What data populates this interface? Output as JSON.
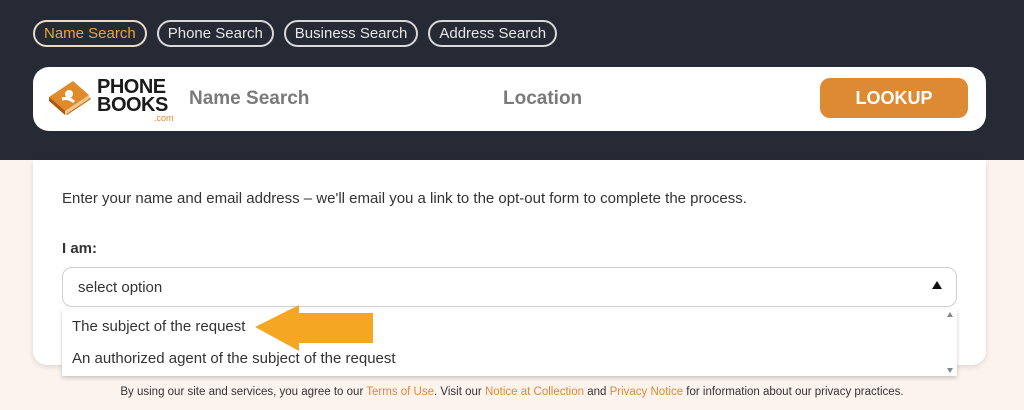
{
  "tabs": [
    {
      "label": "Name Search",
      "active": true
    },
    {
      "label": "Phone Search",
      "active": false
    },
    {
      "label": "Business Search",
      "active": false
    },
    {
      "label": "Address Search",
      "active": false
    }
  ],
  "logo": {
    "line1": "PHONE",
    "line2": "BOOKS",
    "suffix": ".com"
  },
  "search": {
    "name_placeholder": "Name Search",
    "location_placeholder": "Location",
    "button_label": "LOOKUP"
  },
  "form": {
    "instructions": "Enter your name and email address – we'll email you a link to the opt-out form to complete the process.",
    "iam_label": "I am:",
    "select_value": "select option",
    "options": [
      "The subject of the request",
      "An authorized agent of the subject of the request"
    ]
  },
  "footer": {
    "text1": "By using our site and services, you agree to our ",
    "terms": "Terms of Use",
    "text2": ". Visit our ",
    "notice": "Notice at Collection",
    "text3": " and ",
    "privacy": "Privacy Notice",
    "text4": " for information about our privacy practices."
  },
  "colors": {
    "header_bg": "#252a35",
    "accent": "#dd8a33",
    "arrow": "#f5a623",
    "page_bg": "#fdf3ee"
  }
}
